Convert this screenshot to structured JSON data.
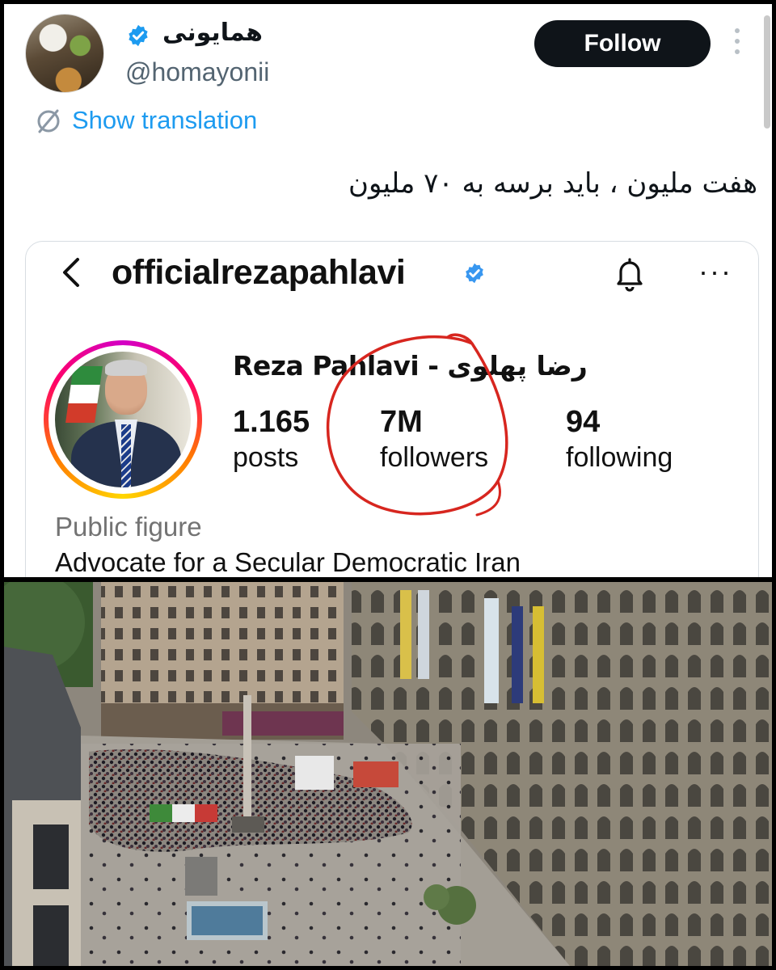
{
  "tweet": {
    "display_name": "همایونی",
    "handle": "@homayonii",
    "follow_label": "Follow",
    "show_translation": "Show translation",
    "text": "هفت ملیون ، باید برسه به ۷۰ ملیون",
    "colors": {
      "link": "#1d9bf0",
      "button_bg": "#0f1419",
      "verified": "#1d9bf0"
    }
  },
  "instagram": {
    "username": "officialrezapahlavi",
    "profile_name": "Reza Pahlavi - رضا پهلوی",
    "stats": {
      "posts_value": "1.165",
      "posts_label": "posts",
      "followers_value": "7M",
      "followers_label": "followers",
      "following_value": "94",
      "following_label": "following"
    },
    "category": "Public figure",
    "bio": "Advocate for a Secular Democratic Iran",
    "icons": [
      "back-arrow-icon",
      "verified-badge-icon",
      "bell-icon",
      "more-icon"
    ],
    "annotation_color": "#d7261f"
  },
  "photo": {
    "subject": "aerial-city-square-crowd"
  }
}
